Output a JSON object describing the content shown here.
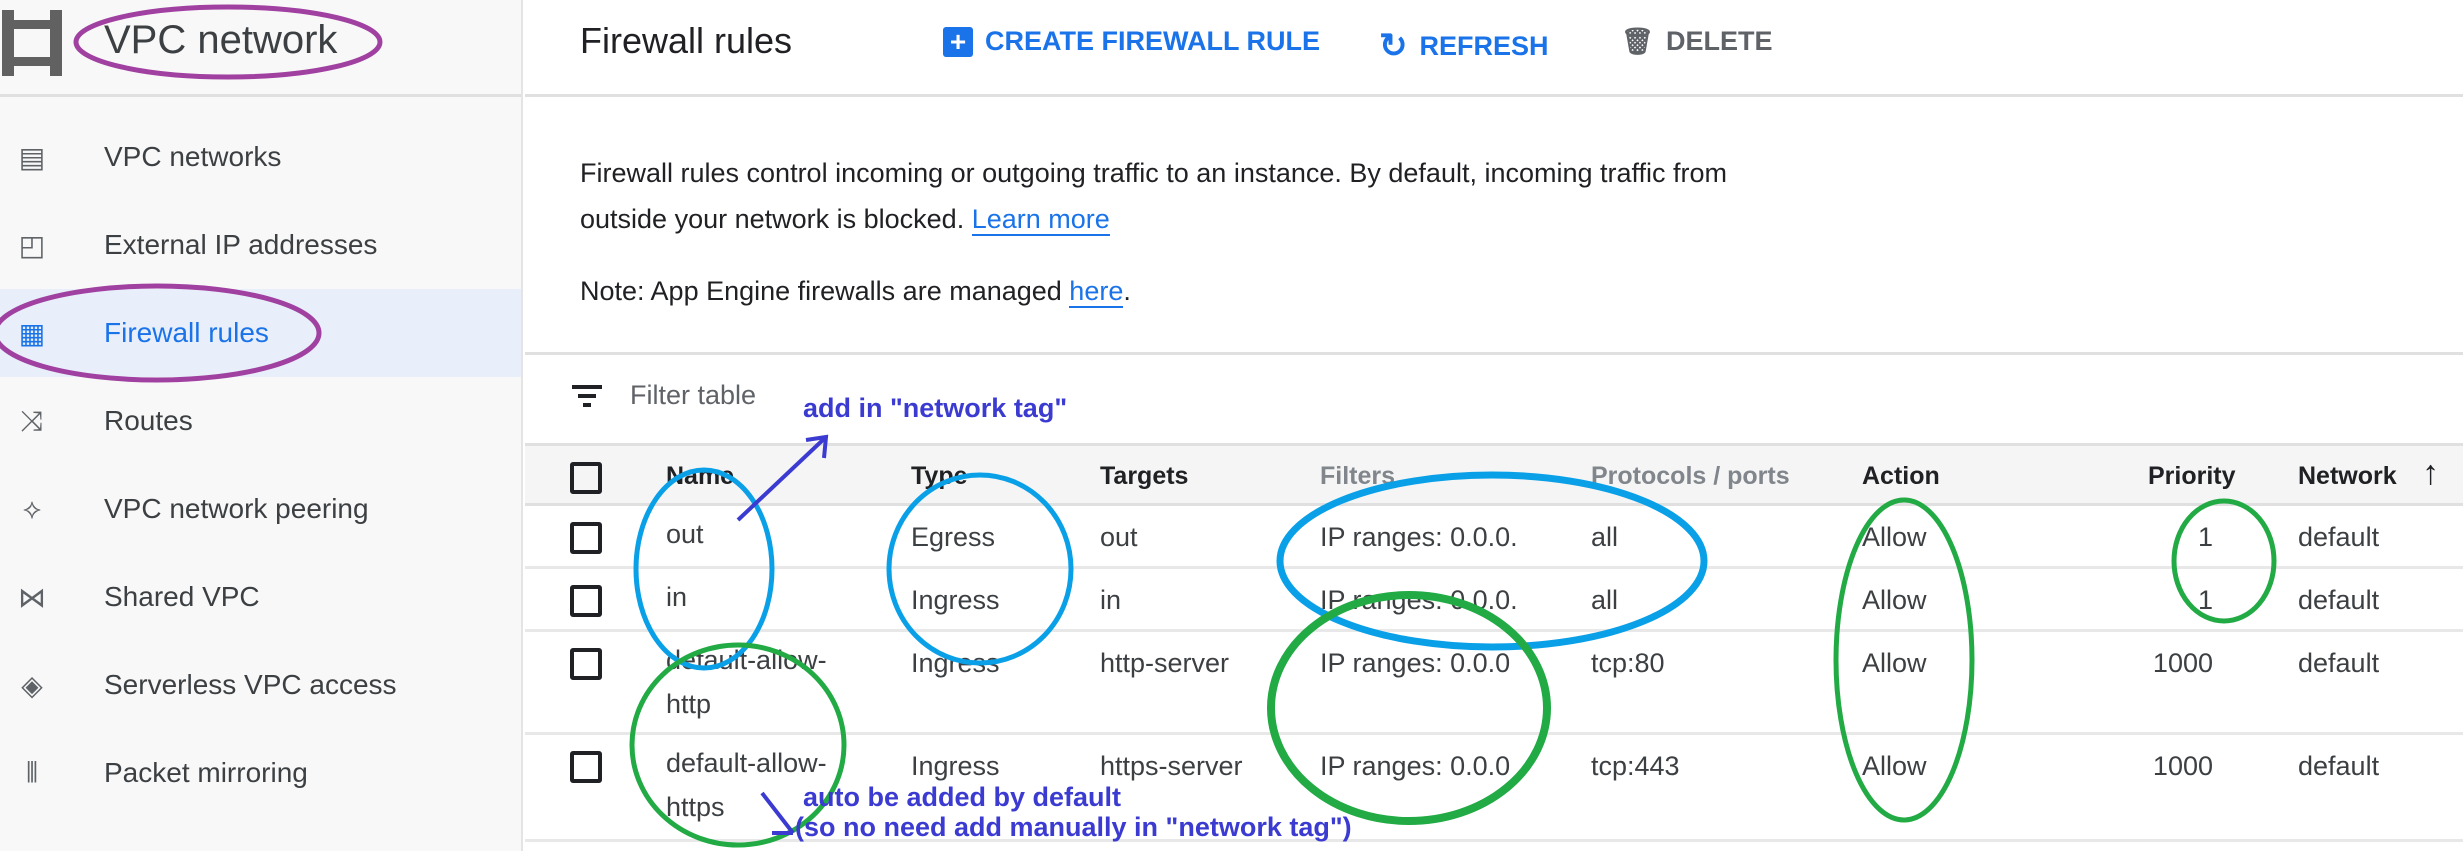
{
  "sidebar": {
    "title": "VPC network",
    "logo_icon": "vpc-network-icon",
    "items": [
      {
        "label": "VPC networks",
        "icon": "vpc-networks-icon",
        "glyph": "▤"
      },
      {
        "label": "External IP addresses",
        "icon": "external-ip-icon",
        "glyph": "◰"
      },
      {
        "label": "Firewall rules",
        "icon": "firewall-icon",
        "glyph": "▦",
        "selected": true
      },
      {
        "label": "Routes",
        "icon": "routes-icon",
        "glyph": "⤨"
      },
      {
        "label": "VPC network peering",
        "icon": "peering-icon",
        "glyph": "⟡"
      },
      {
        "label": "Shared VPC",
        "icon": "shared-vpc-icon",
        "glyph": "⋈"
      },
      {
        "label": "Serverless VPC access",
        "icon": "serverless-icon",
        "glyph": "◈"
      },
      {
        "label": "Packet mirroring",
        "icon": "packet-mirroring-icon",
        "glyph": "⦀"
      }
    ]
  },
  "header": {
    "title": "Firewall rules",
    "create": "CREATE FIREWALL RULE",
    "refresh": "REFRESH",
    "delete": "DELETE",
    "refresh_glyph": "↻",
    "delete_glyph": "🗑"
  },
  "description": {
    "text": "Firewall rules control incoming or outgoing traffic to an instance. By default, incoming traffic from outside your network is blocked.",
    "learn_more": "Learn more",
    "note": "Note: App Engine firewalls are managed ",
    "here": "here",
    "period": "."
  },
  "filter": {
    "placeholder": "Filter table"
  },
  "table": {
    "columns": [
      "Name",
      "Type",
      "Targets",
      "Filters",
      "Protocols / ports",
      "Action",
      "Priority",
      "Network"
    ],
    "sort_glyph": "↑",
    "rows": [
      [
        "out",
        "Egress",
        "out",
        "IP ranges: 0.0.0.",
        "all",
        "Allow",
        "1",
        "default"
      ],
      [
        "in",
        "Ingress",
        "in",
        "IP ranges: 0.0.0.",
        "all",
        "Allow",
        "1",
        "default"
      ],
      [
        "default-allow-http",
        "Ingress",
        "http-server",
        "IP ranges: 0.0.0",
        "tcp:80",
        "Allow",
        "1000",
        "default"
      ],
      [
        "default-allow-https",
        "Ingress",
        "https-server",
        "IP ranges: 0.0.0",
        "tcp:443",
        "Allow",
        "1000",
        "default"
      ]
    ]
  },
  "annotations": {
    "top": "add in \"network tag\"",
    "bottom1": "auto be added by default",
    "bottom2": "(so no need add manually in \"network tag\")",
    "colors": {
      "purple": "#a040a0",
      "blue": "#0aa0e8",
      "green": "#22aa44",
      "text": "#3b3bd1"
    }
  }
}
